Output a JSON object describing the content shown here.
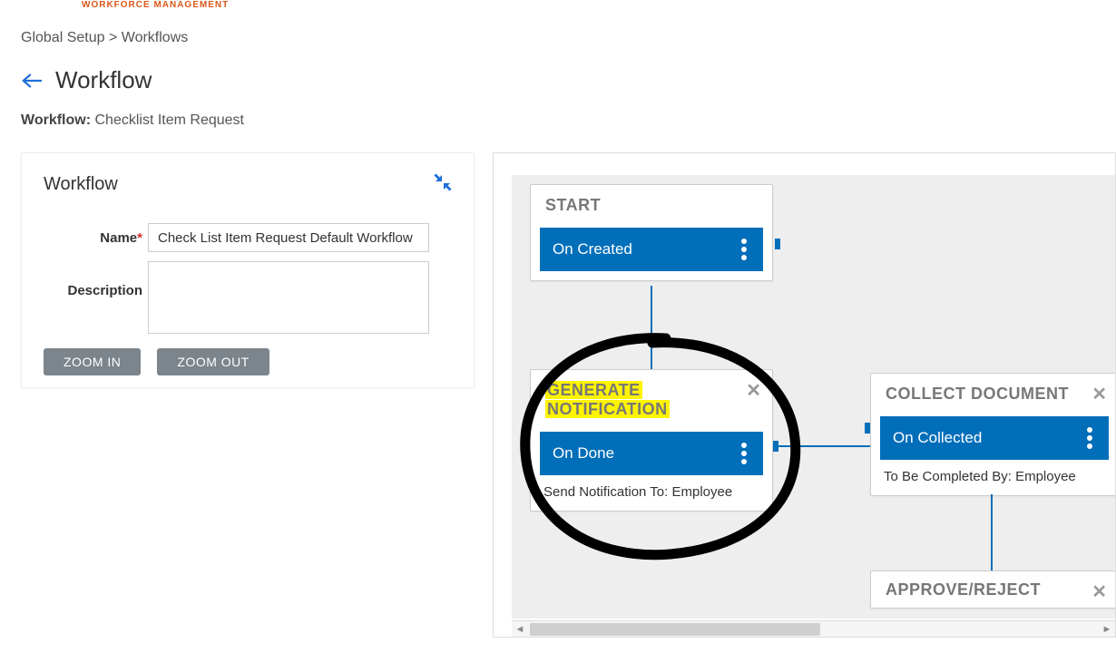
{
  "brand": {
    "subtitle": "WORKFORCE MANAGEMENT"
  },
  "breadcrumb": {
    "part1": "Global Setup",
    "sep": ">",
    "part2": "Workflows"
  },
  "page": {
    "title": "Workflow",
    "type_label": "Workflow:",
    "type_value": "Checklist Item Request"
  },
  "panel": {
    "title": "Workflow",
    "name_label": "Name",
    "name_required_mark": "*",
    "name_value": "Check List Item Request Default Workflow",
    "description_label": "Description",
    "description_value": "",
    "zoom_in": "ZOOM IN",
    "zoom_out": "ZOOM OUT"
  },
  "nodes": {
    "start": {
      "title": "START",
      "action": "On Created"
    },
    "generate": {
      "title_line1": "GENERATE",
      "title_line2": "NOTIFICATION",
      "action": "On Done",
      "footer": "Send Notification To: Employee"
    },
    "collect": {
      "title": "COLLECT DOCUMENT",
      "action": "On Collected",
      "footer": "To Be Completed By: Employee"
    },
    "approve": {
      "title": "APPROVE/REJECT"
    }
  },
  "icons": {
    "close": "✕"
  }
}
